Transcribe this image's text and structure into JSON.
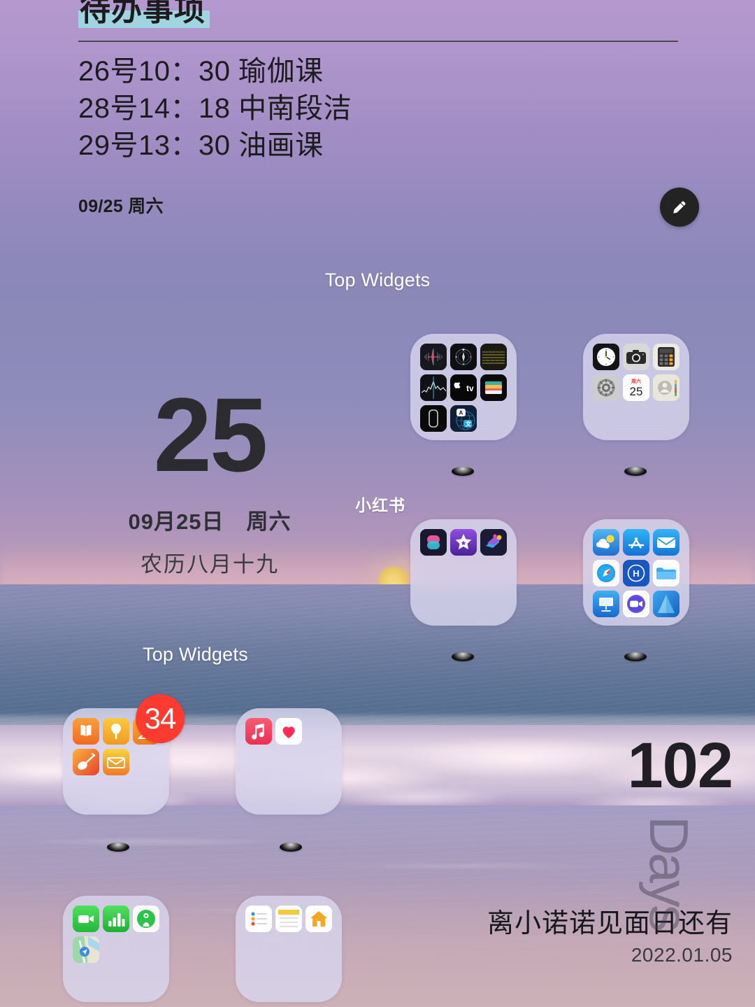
{
  "wallpaper": {
    "scene": "ocean-sunset-beach",
    "sky_color": "#b096cc",
    "sea_color": "#6e7ca0",
    "sand_color": "#c2a6b6"
  },
  "todo_widget": {
    "title": "待办事项",
    "highlight_color": "#9fd4e0",
    "items": [
      "26号10：30 瑜伽课",
      "28号14：18 中南段洁",
      "29号13：30 油画课"
    ],
    "footer_date": "09/25 周六",
    "edit_icon": "pencil-icon"
  },
  "labels": {
    "top_widgets_upper": "Top Widgets",
    "top_widgets_lower": "Top Widgets"
  },
  "date_widget": {
    "day_number": "25",
    "date_line": "09月25日　周六",
    "lunar_line": "农历八月十九"
  },
  "countdown_widget": {
    "number": "102",
    "unit_watermark": "Days",
    "title": "离小诺诺见面日还有",
    "target_date": "2022.01.05"
  },
  "watermark": {
    "text": "小红书"
  },
  "folders": [
    {
      "name": "folder-dark-utilities",
      "apps": [
        {
          "icon": "voice-memos-icon",
          "label": "Voice Memos"
        },
        {
          "icon": "compass-icon",
          "label": "Compass"
        },
        {
          "icon": "measure-icon",
          "label": "Measure"
        },
        {
          "icon": "stocks-icon",
          "label": "Stocks"
        },
        {
          "icon": "apple-tv-icon",
          "label": "Apple TV"
        },
        {
          "icon": "wallet-icon",
          "label": "Wallet"
        },
        {
          "icon": "watch-icon",
          "label": "Watch"
        },
        {
          "icon": "translate-icon",
          "label": "Translate"
        }
      ]
    },
    {
      "name": "folder-system-tools",
      "apps": [
        {
          "icon": "clock-icon",
          "label": "Clock"
        },
        {
          "icon": "camera-icon",
          "label": "Camera"
        },
        {
          "icon": "calculator-icon",
          "label": "Calculator"
        },
        {
          "icon": "settings-icon",
          "label": "Settings"
        },
        {
          "icon": "calendar-icon",
          "label": "Calendar",
          "value": "25",
          "weekday": "周六"
        },
        {
          "icon": "contacts-icon",
          "label": "Contacts"
        }
      ]
    },
    {
      "name": "folder-creative",
      "apps": [
        {
          "icon": "shortcuts-icon",
          "label": "Shortcuts"
        },
        {
          "icon": "imovie-icon",
          "label": "iMovie"
        },
        {
          "icon": "clips-icon",
          "label": "Clips"
        }
      ]
    },
    {
      "name": "folder-blue-apps",
      "apps": [
        {
          "icon": "weather-icon",
          "label": "Weather"
        },
        {
          "icon": "app-store-icon",
          "label": "App Store"
        },
        {
          "icon": "mail-icon",
          "label": "Mail"
        },
        {
          "icon": "safari-icon",
          "label": "Safari"
        },
        {
          "icon": "hotel-app-icon",
          "label": "Hi"
        },
        {
          "icon": "files-icon",
          "label": "Files"
        },
        {
          "icon": "keynote-icon",
          "label": "Keynote"
        },
        {
          "icon": "facetime-icon",
          "label": "FaceTime"
        },
        {
          "icon": "testflight-icon",
          "label": "TestFlight"
        }
      ]
    },
    {
      "name": "folder-orange-apps",
      "badge": "34",
      "badge_color": "#ff3b30",
      "apps": [
        {
          "icon": "books-icon",
          "label": "Books"
        },
        {
          "icon": "tips-icon",
          "label": "Tips"
        },
        {
          "icon": "pages-icon",
          "label": "Pages"
        },
        {
          "icon": "garageband-icon",
          "label": "GarageBand"
        },
        {
          "icon": "mail-orange-icon",
          "label": "Mail"
        }
      ]
    },
    {
      "name": "folder-media",
      "apps": [
        {
          "icon": "music-icon",
          "label": "Music"
        },
        {
          "icon": "health-icon",
          "label": "Health"
        }
      ]
    },
    {
      "name": "folder-green-apps",
      "apps": [
        {
          "icon": "facetime-green-icon",
          "label": "FaceTime"
        },
        {
          "icon": "numbers-icon",
          "label": "Numbers"
        },
        {
          "icon": "find-my-icon",
          "label": "Find My"
        },
        {
          "icon": "maps-icon",
          "label": "Maps"
        }
      ]
    },
    {
      "name": "folder-white-apps",
      "apps": [
        {
          "icon": "reminders-icon",
          "label": "Reminders"
        },
        {
          "icon": "notes-icon",
          "label": "Notes"
        },
        {
          "icon": "home-icon",
          "label": "Home"
        }
      ]
    }
  ]
}
